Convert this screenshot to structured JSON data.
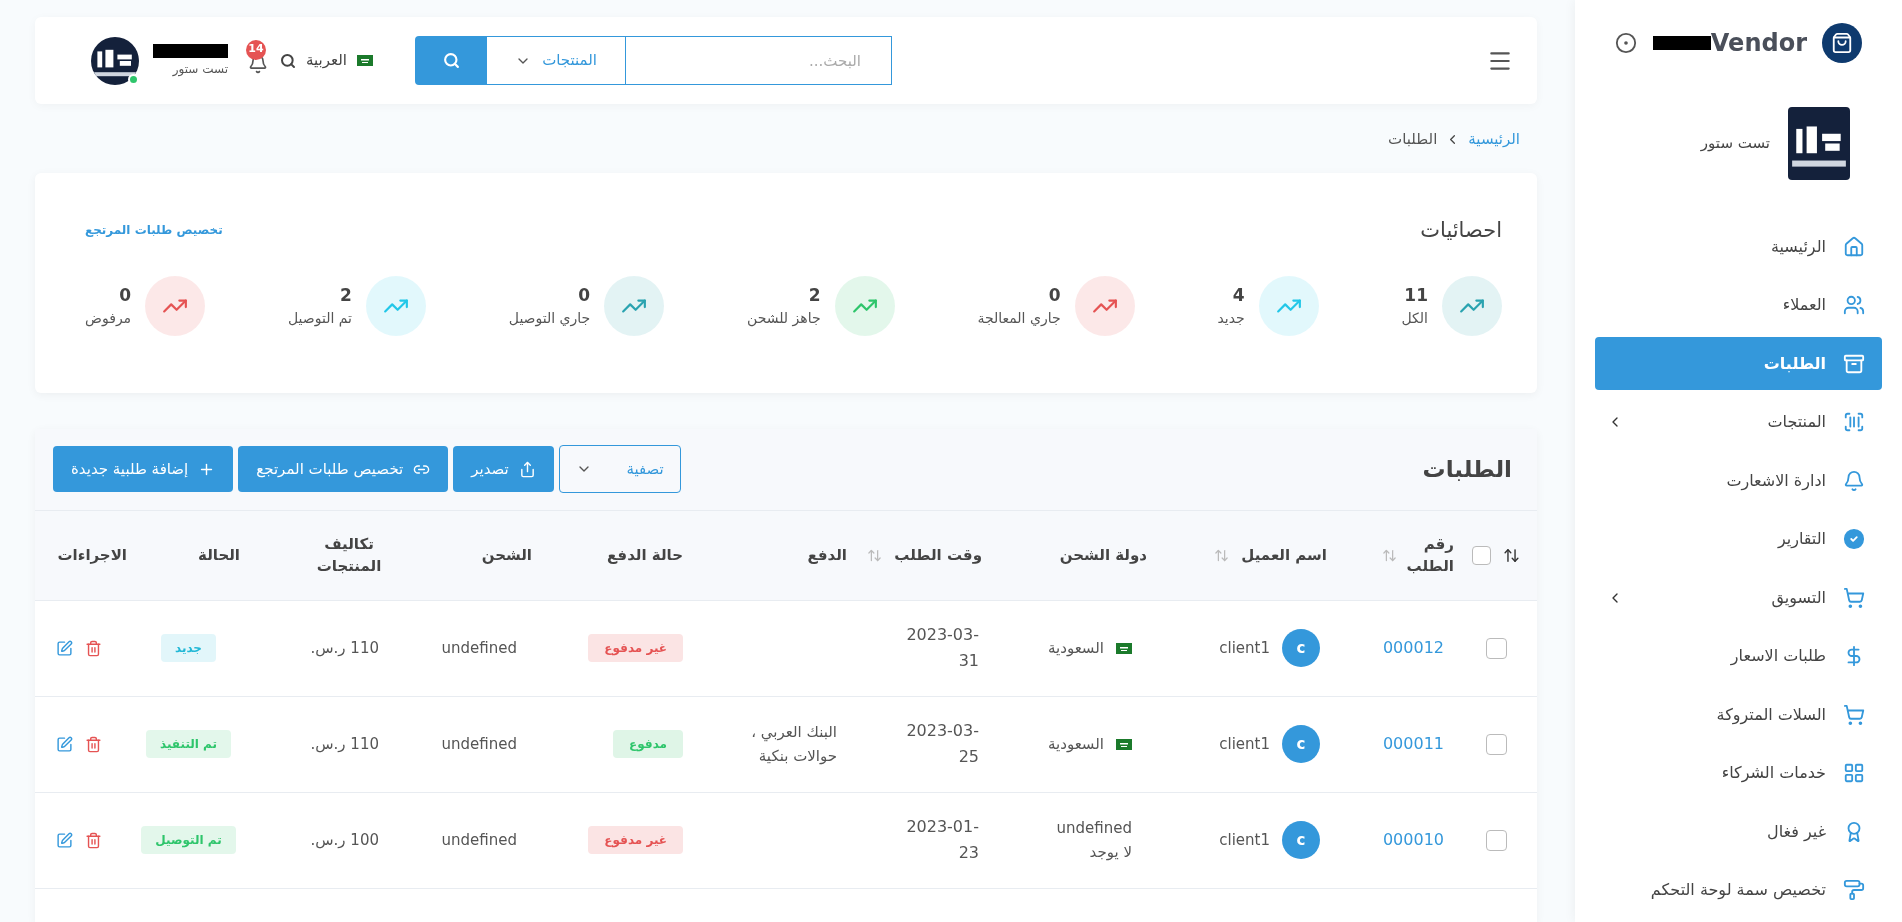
{
  "sidebar": {
    "brand": "Vendor",
    "store_name": "تست ستور",
    "items": [
      {
        "label": "الرئيسية",
        "selected": false,
        "expandable": false
      },
      {
        "label": "العملاء",
        "selected": false,
        "expandable": false
      },
      {
        "label": "الطلبات",
        "selected": true,
        "expandable": false
      },
      {
        "label": "المنتجات",
        "selected": false,
        "expandable": true
      },
      {
        "label": "ادارة الاشعارت",
        "selected": false,
        "expandable": false
      },
      {
        "label": "التقارير",
        "selected": false,
        "expandable": false
      },
      {
        "label": "التسويق",
        "selected": false,
        "expandable": true
      },
      {
        "label": "طلبات الاسعار",
        "selected": false,
        "expandable": false
      },
      {
        "label": "السلات المتروكة",
        "selected": false,
        "expandable": false
      },
      {
        "label": "خدمات الشركاء",
        "selected": false,
        "expandable": false
      },
      {
        "label": "غير فغال",
        "selected": false,
        "expandable": false
      },
      {
        "label": "تخصيص سمة لوحة التحكم",
        "selected": false,
        "expandable": false
      }
    ]
  },
  "topbar": {
    "search": {
      "placeholder": "البحث...",
      "scope": "المنتجات"
    },
    "language": "العربية",
    "notifications": "14",
    "user": {
      "store": "تست ستور",
      "online": true
    }
  },
  "breadcrumb": [
    {
      "label": "الرئيسية",
      "link": true
    },
    {
      "label": "الطلبات",
      "link": false
    }
  ],
  "stats": {
    "title": "احصائيات",
    "link": "تخصيص طلبات المرتجع",
    "items": [
      {
        "value": "11",
        "label": "الكل",
        "color": "#2aa3b0"
      },
      {
        "value": "4",
        "label": "جديد",
        "color": "#22c7e8"
      },
      {
        "value": "0",
        "label": "جاري المعالجة",
        "color": "#e55353"
      },
      {
        "value": "2",
        "label": "جاهز للشحن",
        "color": "#2ec56b"
      },
      {
        "value": "0",
        "label": "جاري التوصيل",
        "color": "#2aa3b0"
      },
      {
        "value": "2",
        "label": "تم التوصيل",
        "color": "#22c7e8"
      },
      {
        "value": "0",
        "label": "مرفوض",
        "color": "#e55353"
      }
    ]
  },
  "orders": {
    "title": "الطلبات",
    "filter": "تصفية",
    "buttons": [
      {
        "kind": "export",
        "label": "تصدير"
      },
      {
        "kind": "link",
        "label": "تخصيص طلبات المرتجع"
      },
      {
        "kind": "add",
        "label": "إضافة طلبية جديدة"
      }
    ],
    "select_all": {
      "checked": false
    },
    "columns": [
      {
        "label": "رقم الطلب",
        "sortable": true
      },
      {
        "label": "اسم العميل",
        "sortable": true
      },
      {
        "label": "دولة الشحن",
        "sortable": false
      },
      {
        "label": "وقت الطلب",
        "sortable": true
      },
      {
        "label": "الدفع",
        "sortable": false
      },
      {
        "label": "حالة الدفع",
        "sortable": false
      },
      {
        "label": "الشحن",
        "sortable": false
      },
      {
        "label": "تكاليف المنتجات",
        "sortable": false
      },
      {
        "label": "الحالة",
        "sortable": false
      },
      {
        "label": "الاجراءات",
        "sortable": false
      }
    ],
    "rows": [
      {
        "checked": false,
        "id": "000012",
        "avatar": "c",
        "client": "client1",
        "country": {
          "flag": true,
          "lines": [
            "السعودية"
          ]
        },
        "time": [
          "2023-03-",
          "31"
        ],
        "payment": [],
        "paid": false,
        "pay_status": "غير مدفوع",
        "shipping": "undefined",
        "cost": "110 ر.س.",
        "status": {
          "label": "جديد",
          "color": "#22b8d6"
        }
      },
      {
        "checked": false,
        "id": "000011",
        "avatar": "c",
        "client": "client1",
        "country": {
          "flag": true,
          "lines": [
            "السعودية"
          ]
        },
        "time": [
          "2023-03-",
          "25"
        ],
        "payment": [
          "البنك العربي ،",
          "حوالات بنكية"
        ],
        "paid": true,
        "pay_status": "مدفوع",
        "shipping": "undefined",
        "cost": "110 ر.س.",
        "status": {
          "label": "تم التنفيذ",
          "color": "#2ec56b"
        }
      },
      {
        "checked": false,
        "id": "000010",
        "avatar": "c",
        "client": "client1",
        "country": {
          "flag": false,
          "lines": [
            "undefined",
            "لا يوجد"
          ]
        },
        "time": [
          "2023-01-",
          "23"
        ],
        "payment": [],
        "paid": false,
        "pay_status": "غير مدفوع",
        "shipping": "undefined",
        "cost": "100 ر.س.",
        "status": {
          "label": "تم التوصيل",
          "color": "#2ec56b"
        }
      }
    ]
  }
}
